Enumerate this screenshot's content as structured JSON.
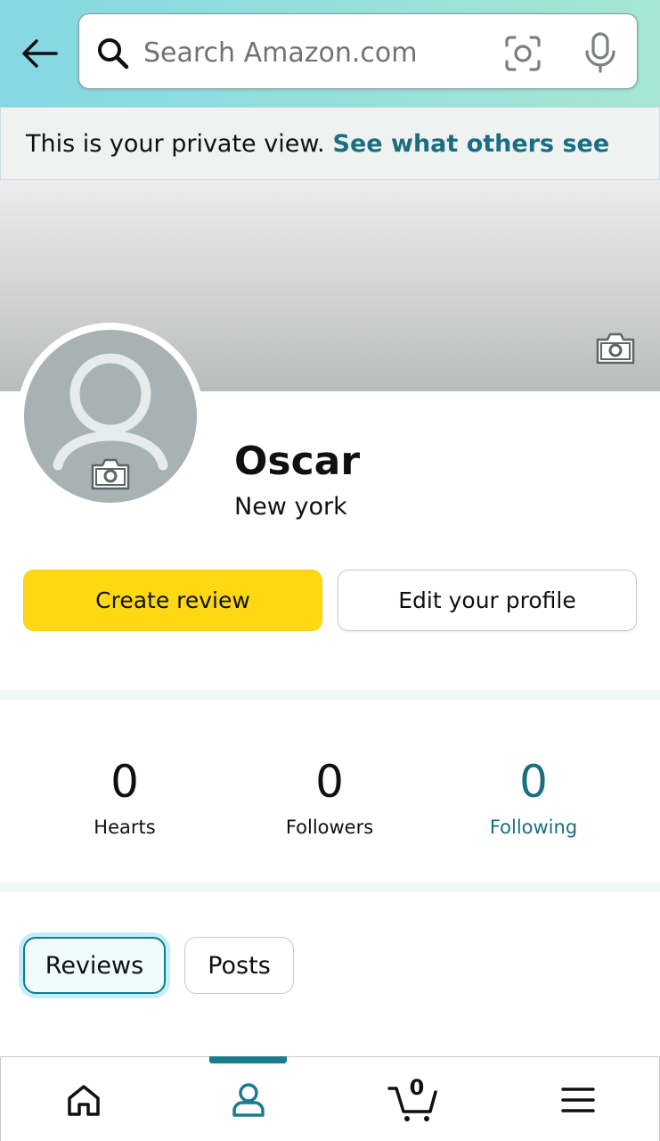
{
  "colors": {
    "accent_teal": "#1a6e80",
    "primary_button": "#ffd814",
    "header_gradient_start": "#84d8e3",
    "header_gradient_end": "#a6e6d3",
    "avatar_bg": "#a8b1b4"
  },
  "header": {
    "back_icon": "back-arrow-icon",
    "search": {
      "placeholder": "Search Amazon.com",
      "value": "",
      "icon": "search-icon",
      "camera_icon": "camera-search-icon",
      "mic_icon": "microphone-icon"
    }
  },
  "banner": {
    "text": "This is your private view.",
    "link": "See what others see"
  },
  "profile": {
    "name": "Oscar",
    "location": "New york",
    "cover_camera_icon": "camera-icon",
    "avatar_camera_icon": "camera-icon"
  },
  "actions": {
    "create_review": "Create review",
    "edit_profile": "Edit your profile"
  },
  "stats": [
    {
      "value": "0",
      "label": "Hearts"
    },
    {
      "value": "0",
      "label": "Followers"
    },
    {
      "value": "0",
      "label": "Following"
    }
  ],
  "tabs": [
    {
      "label": "Reviews",
      "selected": true
    },
    {
      "label": "Posts",
      "selected": false
    }
  ],
  "bottom_nav": {
    "items": [
      {
        "icon": "home-icon"
      },
      {
        "icon": "profile-icon",
        "active": true
      },
      {
        "icon": "cart-icon"
      },
      {
        "icon": "menu-icon"
      }
    ],
    "cart_count": "0"
  }
}
